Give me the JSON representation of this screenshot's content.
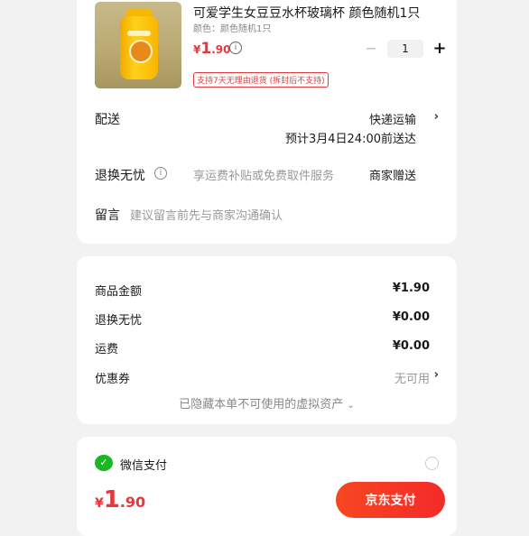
{
  "product": {
    "title": "可爱学生女豆豆水杯玻璃杯 颜色随机1只",
    "variant": "颜色：颜色随机1只",
    "price_currency": "¥",
    "price_integer": "1",
    "price_decimal": ".90",
    "quantity": "1",
    "return_badge": "支持7天无理由退货 (拆封后不支持)"
  },
  "delivery": {
    "label": "配送",
    "method": "快递运输",
    "eta": "预计3月4日24:00前送达"
  },
  "returns": {
    "label": "退换无忧",
    "desc": "享运费补贴或免费取件服务",
    "value": "商家赠送"
  },
  "message": {
    "label": "留言",
    "placeholder": "建议留言前先与商家沟通确认"
  },
  "summary": {
    "rows": [
      {
        "label": "商品金额",
        "value": "¥1.90"
      },
      {
        "label": "退换无忧",
        "value": "¥0.00"
      },
      {
        "label": "运费",
        "value": "¥0.00"
      }
    ],
    "coupon_label": "优惠券",
    "coupon_value": "无可用",
    "hidden_note": "已隐藏本单不可使用的虚拟资产"
  },
  "payment": {
    "wechat_label": "微信支付"
  },
  "footer": {
    "total_currency": "¥",
    "total_integer": "1",
    "total_decimal": ".90",
    "pay_button": "京东支付"
  },
  "icons": {
    "info": "info-icon",
    "plus": "plus-icon",
    "minus": "minus-icon",
    "chevron": "chevron-right-icon",
    "wechat": "wechat-icon"
  },
  "colors": {
    "accent": "#e4393c",
    "pay_button": "#f32a2a",
    "wechat": "#1bb723"
  }
}
